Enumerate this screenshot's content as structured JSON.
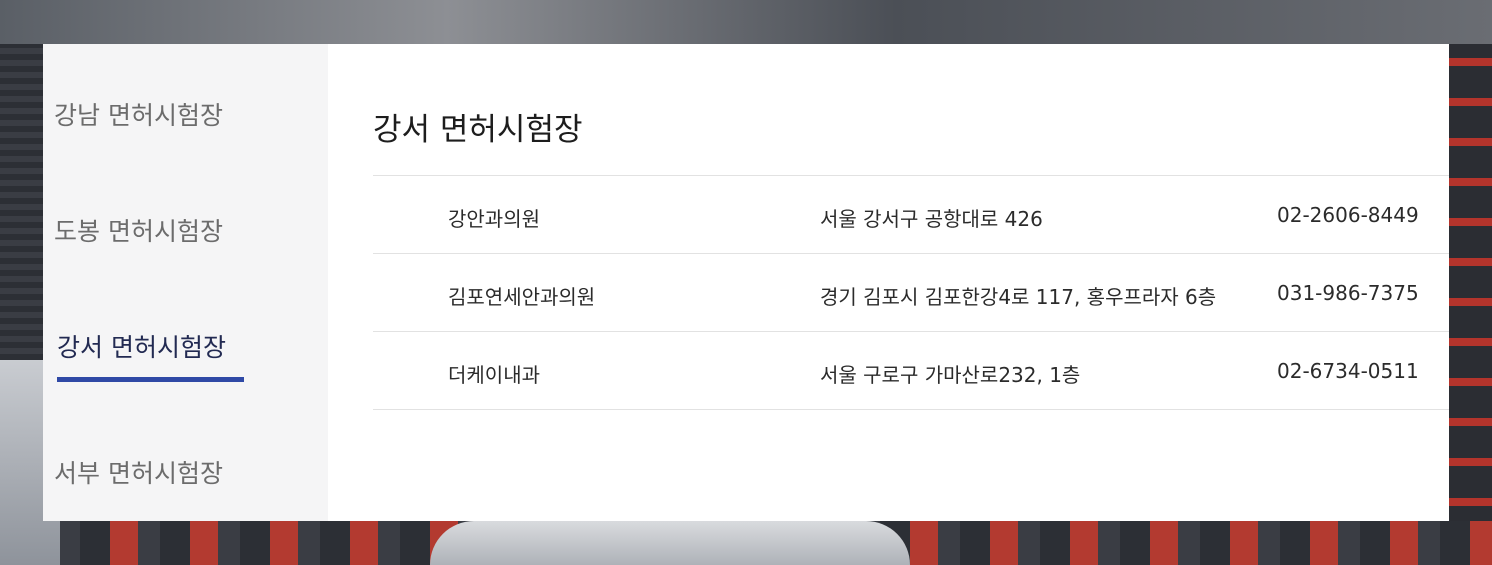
{
  "sidebar": {
    "items": [
      {
        "label": "강남 면허시험장"
      },
      {
        "label": "도봉 면허시험장"
      },
      {
        "label": "강서 면허시험장"
      },
      {
        "label": "서부 면허시험장"
      }
    ],
    "active_index": 2,
    "accent_color": "#2f49a6"
  },
  "main": {
    "title": "강서 면허시험장",
    "rows": [
      {
        "name": "강안과의원",
        "address": "서울 강서구 공항대로 426",
        "phone": "02-2606-8449"
      },
      {
        "name": "김포연세안과의원",
        "address": "경기 김포시 김포한강4로 117, 홍우프라자 6층",
        "phone": "031-986-7375"
      },
      {
        "name": "더케이내과",
        "address": "서울 구로구 가마산로232, 1층",
        "phone": "02-6734-0511"
      }
    ]
  }
}
